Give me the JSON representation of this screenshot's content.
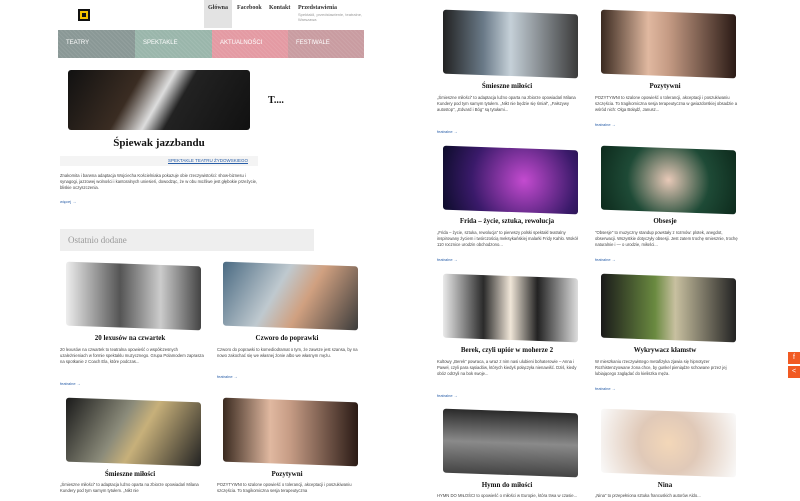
{
  "header": {
    "nav": [
      "Główna",
      "Facebook",
      "Kontakt",
      "Przedstawienia"
    ],
    "tagline": "Spektakli, przedstawienie, teatralne, Warszawa"
  },
  "categories": [
    {
      "label": "TEATRY",
      "color": "#8a9896"
    },
    {
      "label": "SPEKTAKLE",
      "color": "#9ab6ab"
    },
    {
      "label": "AKTUALNOŚCI",
      "color": "#e49aa3"
    },
    {
      "label": "FESTIWALE",
      "color": "#c99ca1"
    }
  ],
  "featured": {
    "title": "Śpiewak jazzbandu",
    "side_text": "T....",
    "theatre": "SPEKTAKLE TEATRU ŻYDOWSKIEGO",
    "excerpt": "Znakomita i barwna adaptacja Wojciecha Kościelniaka pokazuje obie rzeczywistości: show-biznesu i synagogi, jazzowej wolności i kantoralnych uniesień, dowodząc, że w obu możliwe jest głębokie przeżycie, bliskie oczyszczenia.",
    "more": "więcej →"
  },
  "latest_heading": "Ostatnio dodane",
  "left_cards": [
    {
      "title": "20 lexusów na czwartek",
      "excerpt": "20 lexusów na czwartek to teatralna opowieść o współczesnych uzależnieniach w formie spektaklu muzycznego. Grupa Polamodem zaprasza na spotkanie z Coach Ela, które podczas...",
      "more": "featralne →"
    },
    {
      "title": "Czworo do poprawki",
      "excerpt": "Czworo do poprawki to komediodramat o tym, że zawsze jest szansa, by na nowo zakochać się we własnej żonie albo we własnym mężu.",
      "more": "featralne →"
    },
    {
      "title": "Śmieszne miłości",
      "excerpt": "„Śmieszne miłości” to adaptacja luźno oparta na zbiorze opowiadań Milana Kundery pod tym samym tytułem. „Nikt nie",
      "more": ""
    },
    {
      "title": "Pozytywni",
      "excerpt": "POZYTYWNI to szalone opowieść o tolerancji, akceptacji i poszukiwaniu szczęścia. To tragikomiczna sesja terapeutyczna",
      "more": ""
    }
  ],
  "right_cards": [
    {
      "title": "Śmieszne miłości",
      "excerpt": "„Śmieszne miłości” to adaptacja luźno oparta na zbiorze opowiadań Milana Kundery pod tym samym tytułem. „Nikt nie będzie się śmiał”, „Fałszywy autostop”, „Edvard i Bóg” są tytułami...",
      "more": "featralne →"
    },
    {
      "title": "Pozytywni",
      "excerpt": "POZYTYWNI to szalone opowieść o tolerancji, akceptacji i poszukiwaniu szczęścia. To tragikomiczna sesja terapeutyczna w gwiazdorskiej obsadzie a wśród nich: Olga Bołądź, Janusz...",
      "more": "featralne →"
    },
    {
      "title": "Frida – życie, sztuka, rewolucja",
      "excerpt": "„Frida – życie, sztuka, rewolucja” to pierwszy polski spektakl teatralny inspirowany życiem i twórczością meksykańskiej malarki Fridy Kahlo. Wokół 110 rocznice urodzin obchodzono...",
      "more": "featralne →"
    },
    {
      "title": "Obsesje",
      "excerpt": "\"Obsesje\" to muzyczny standup powstały z rozmów: plotek, anegdot, obserwacji. Wszystkie dotyczyły obsesji. Jest zatem trochę smiesznie, trochę naturalnie i — o urodzie, miłości...",
      "more": "featralne →"
    },
    {
      "title": "Berek, czyli upiór w moherze 2",
      "excerpt": "Kultowy „Berek” powraca, a wraz z nim nasi ulubieni bohaterowie – Anna i Paweł, czyli para sąsiadów, których kiedyś połączyła nienawiść. Dziś, kiedy obóz odrzyli na bok swoje...",
      "more": "featralne →"
    },
    {
      "title": "Wykrywacz kłamstw",
      "excerpt": "W mieszkaniu rzeczywistego metafizyka zjawia się hipnotyzer Rozhistenzyowane żona chce, by gunkel pieniądze schowane przez jej lubiającego zaglądać do kieliszka męża.",
      "more": "featralne →"
    },
    {
      "title": "Hymn do miłości",
      "excerpt": "HYMN DO MIŁOŚCI to opowieść o miłości w Europie, która trwa w czasie...",
      "more": ""
    },
    {
      "title": "Nina",
      "excerpt": "„Nina” to przepełniona sztuka francuskich autorów Aldo...",
      "more": ""
    }
  ],
  "side_buttons": [
    {
      "label": "f",
      "color": "#f15a22"
    },
    {
      "label": "<",
      "color": "#f15a22"
    }
  ]
}
